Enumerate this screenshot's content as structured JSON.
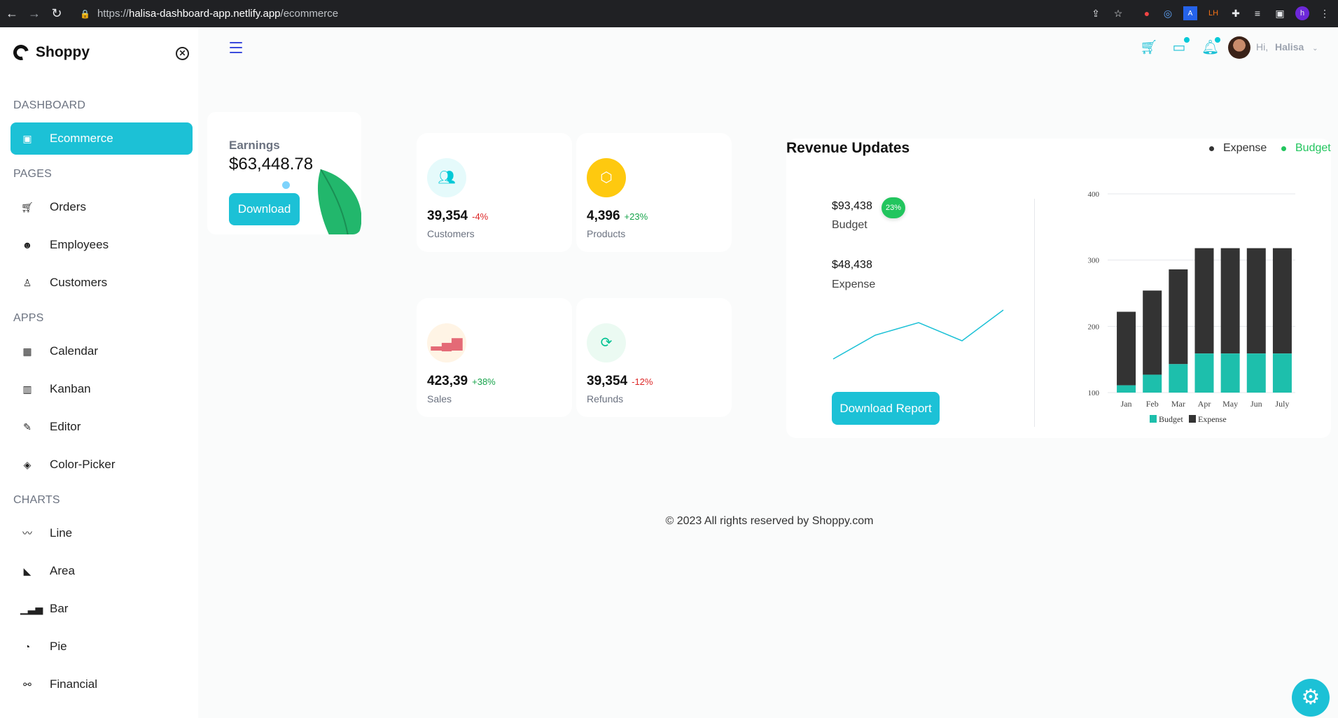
{
  "browser": {
    "url_scheme": "https://",
    "url_host": "halisa-dashboard-app.netlify.app",
    "url_path": "/ecommerce"
  },
  "sidebar": {
    "brand": "Shoppy",
    "sections": {
      "dashboard": "DASHBOARD",
      "pages": "PAGES",
      "apps": "APPS",
      "charts": "CHARTS"
    },
    "items": [
      {
        "label": "Ecommerce",
        "icon": "shopping-bag-icon",
        "active": true
      },
      {
        "label": "Orders",
        "icon": "cart-icon"
      },
      {
        "label": "Employees",
        "icon": "employees-icon"
      },
      {
        "label": "Customers",
        "icon": "customers-icon"
      },
      {
        "label": "Calendar",
        "icon": "calendar-icon"
      },
      {
        "label": "Kanban",
        "icon": "kanban-icon"
      },
      {
        "label": "Editor",
        "icon": "edit-icon"
      },
      {
        "label": "Color-Picker",
        "icon": "color-picker-icon"
      },
      {
        "label": "Line",
        "icon": "line-chart-icon"
      },
      {
        "label": "Area",
        "icon": "area-chart-icon"
      },
      {
        "label": "Bar",
        "icon": "bar-chart-icon"
      },
      {
        "label": "Pie",
        "icon": "pie-chart-icon"
      },
      {
        "label": "Financial",
        "icon": "financial-icon"
      }
    ]
  },
  "header": {
    "greeting": "Hi,",
    "user_name": "Halisa"
  },
  "earnings": {
    "label": "Earnings",
    "value": "$63,448.78",
    "button": "Download"
  },
  "stats": [
    {
      "value": "39,354",
      "pct": "-4%",
      "label": "Customers",
      "trend": "neg",
      "icon": "customers-icon",
      "icon_color": "#03c9d7",
      "icon_bg": "#e5fafb"
    },
    {
      "value": "4,396",
      "pct": "+23%",
      "label": "Products",
      "trend": "pos",
      "icon": "box-icon",
      "icon_color": "#ffffff",
      "icon_bg": "#fec90f"
    },
    {
      "value": "423,39",
      "pct": "+38%",
      "label": "Sales",
      "trend": "pos",
      "icon": "bar-chart-icon",
      "icon_color": "#e46a76",
      "icon_bg": "#fff4e5"
    },
    {
      "value": "39,354",
      "pct": "-12%",
      "label": "Refunds",
      "trend": "neg",
      "icon": "refresh-icon",
      "icon_color": "#00c292",
      "icon_bg": "#ebfaf2"
    }
  ],
  "revenue": {
    "title": "Revenue Updates",
    "legend_expense": "Expense",
    "legend_budget": "Budget",
    "budget_value": "$93,438",
    "budget_pct": "23%",
    "budget_label": "Budget",
    "expense_value": "$48,438",
    "expense_label": "Expense",
    "button": "Download Report",
    "colors": {
      "budget": "#1dbfac",
      "expense": "#333333",
      "legend_budget": "#22c55e"
    }
  },
  "chart_data": {
    "type": "bar",
    "stacked": true,
    "categories": [
      "Jan",
      "Feb",
      "Mar",
      "Apr",
      "May",
      "Jun",
      "July"
    ],
    "series": [
      {
        "name": "Budget",
        "values": [
          111,
          127,
          143,
          159,
          159,
          159,
          159
        ]
      },
      {
        "name": "Expense",
        "values": [
          111,
          127,
          143,
          159,
          159,
          159,
          159
        ]
      }
    ],
    "ylim": [
      100,
      400
    ],
    "yticks": [
      100,
      200,
      300,
      400
    ],
    "legend": "bottom"
  },
  "footer": "© 2023 All rights reserved by Shoppy.com"
}
